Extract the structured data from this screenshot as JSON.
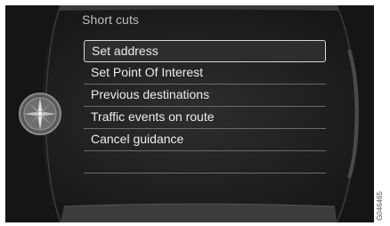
{
  "header": {
    "title": "Short cuts"
  },
  "menu": {
    "items": [
      {
        "label": "Set address",
        "selected": true
      },
      {
        "label": "Set Point Of Interest",
        "selected": false
      },
      {
        "label": "Previous destinations",
        "selected": false
      },
      {
        "label": "Traffic events on route",
        "selected": false
      },
      {
        "label": "Cancel guidance",
        "selected": false
      },
      {
        "label": "",
        "selected": false
      }
    ]
  },
  "icons": {
    "navigation": "compass-icon"
  },
  "figure_code": "G046465",
  "colors": {
    "background": "#202020",
    "text": "#ececec",
    "title": "#bfbfbf",
    "highlight_border": "#d6d6d6"
  }
}
